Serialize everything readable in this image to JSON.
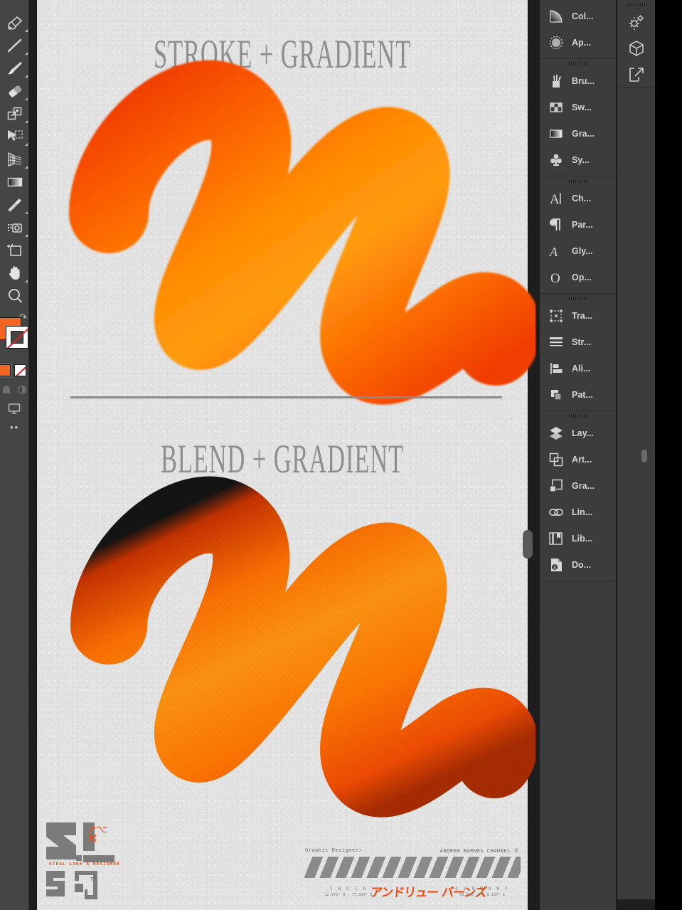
{
  "app": {
    "name": "Adobe Illustrator"
  },
  "toolbar": {
    "tools": [
      {
        "name": "pen-tool",
        "label": "Pen Tool"
      },
      {
        "name": "line-segment-tool",
        "label": "Line Segment Tool"
      },
      {
        "name": "paintbrush-tool",
        "label": "Paintbrush Tool"
      },
      {
        "name": "eraser-tool",
        "label": "Eraser Tool"
      },
      {
        "name": "shape-builder-tool",
        "label": "Shape Builder Tool"
      },
      {
        "name": "free-transform-tool",
        "label": "Free Transform Tool"
      },
      {
        "name": "perspective-grid-tool",
        "label": "Perspective Grid Tool"
      },
      {
        "name": "gradient-tool",
        "label": "Gradient Tool"
      },
      {
        "name": "eyedropper-tool",
        "label": "Eyedropper Tool"
      },
      {
        "name": "column-graph-tool",
        "label": "Column Graph Tool"
      },
      {
        "name": "artboard-tool",
        "label": "Artboard Tool"
      },
      {
        "name": "hand-tool",
        "label": "Hand Tool"
      },
      {
        "name": "zoom-tool",
        "label": "Zoom Tool"
      }
    ],
    "colors": {
      "fill": "#f26522",
      "stroke": "#ffffff",
      "stroke_none": true,
      "none_slash": "#e02020"
    },
    "swap_label": "Swap Fill and Stroke",
    "more_label": "Edit Toolbar"
  },
  "canvas": {
    "artboard": {
      "background": "#e9e9e9",
      "titles": [
        {
          "id": "title-1",
          "text": "STROKE + GRADIENT"
        },
        {
          "id": "title-2",
          "text": "BLEND + GRADIENT"
        }
      ],
      "divider_color": "#8b8b8b",
      "artwork": {
        "gradient_light": "#ff9a00",
        "gradient_mid": "#ff7a00",
        "gradient_dark": "#f44500",
        "shape": "zigzag-swirl-stroke"
      },
      "logo": {
        "tagline": "STEAL LIKE A DESIGNER",
        "trademark": "TM",
        "accent": "#f04a13"
      },
      "info": {
        "left_label": "Graphic Designer↗",
        "right_label": "ANDREW BARNES CHANNEL Ⓡ",
        "jp_name": "アンドリュー バーンズ",
        "geo_left_name": "I N D I A",
        "geo_left_coords": "12.971° N – 77.594° E",
        "geo_right_name": "G E R M A N Y",
        "geo_right_coords": "48.783° N – 9.187° E",
        "stripe_color": "#8a8a8a",
        "accent": "#f04a13"
      }
    },
    "collapse_handle_label": "Collapse Panel"
  },
  "dock": {
    "groups": [
      {
        "name": "group-color",
        "has_grip": false,
        "items": [
          {
            "name": "color-panel",
            "label": "Col...",
            "icon": "color-icon"
          },
          {
            "name": "appearance-panel",
            "label": "Ap...",
            "icon": "appearance-icon"
          }
        ]
      },
      {
        "name": "group-brushes",
        "has_grip": true,
        "items": [
          {
            "name": "brushes-panel",
            "label": "Bru...",
            "icon": "brushes-icon"
          },
          {
            "name": "swatches-panel",
            "label": "Sw...",
            "icon": "swatches-icon"
          },
          {
            "name": "gradient-panel",
            "label": "Gra...",
            "icon": "gradient-icon"
          },
          {
            "name": "symbols-panel",
            "label": "Sy...",
            "icon": "symbols-icon"
          }
        ]
      },
      {
        "name": "group-type",
        "has_grip": true,
        "items": [
          {
            "name": "character-panel",
            "label": "Ch...",
            "icon": "character-icon"
          },
          {
            "name": "paragraph-panel",
            "label": "Par...",
            "icon": "paragraph-icon"
          },
          {
            "name": "glyphs-panel",
            "label": "Gly...",
            "icon": "glyphs-icon"
          },
          {
            "name": "opentype-panel",
            "label": "Op...",
            "icon": "opentype-icon"
          }
        ]
      },
      {
        "name": "group-transform",
        "has_grip": true,
        "items": [
          {
            "name": "transform-panel",
            "label": "Tra...",
            "icon": "transform-icon"
          },
          {
            "name": "stroke-panel",
            "label": "Str...",
            "icon": "stroke-icon"
          },
          {
            "name": "align-panel",
            "label": "Ali...",
            "icon": "align-icon"
          },
          {
            "name": "pathfinder-panel",
            "label": "Pat...",
            "icon": "pathfinder-icon"
          }
        ]
      },
      {
        "name": "group-layers",
        "has_grip": true,
        "items": [
          {
            "name": "layers-panel",
            "label": "Lay...",
            "icon": "layers-icon"
          },
          {
            "name": "artboards-panel",
            "label": "Art...",
            "icon": "artboards-icon"
          },
          {
            "name": "graphic-styles-panel",
            "label": "Gra...",
            "icon": "graphic-styles-icon"
          },
          {
            "name": "links-panel",
            "label": "Lin...",
            "icon": "links-icon"
          },
          {
            "name": "libraries-panel",
            "label": "Lib...",
            "icon": "libraries-icon"
          },
          {
            "name": "document-info-panel",
            "label": "Do...",
            "icon": "document-info-icon"
          }
        ]
      }
    ],
    "utility": {
      "has_grip": true,
      "items": [
        {
          "name": "properties-gear-panel",
          "label": "Properties",
          "icon": "gear-icon"
        },
        {
          "name": "three-d-panel",
          "label": "3D and Materials",
          "icon": "cube-icon"
        },
        {
          "name": "export-panel",
          "label": "Asset Export",
          "icon": "export-icon"
        }
      ]
    },
    "collapse_handle_label": "Expand Panels"
  }
}
